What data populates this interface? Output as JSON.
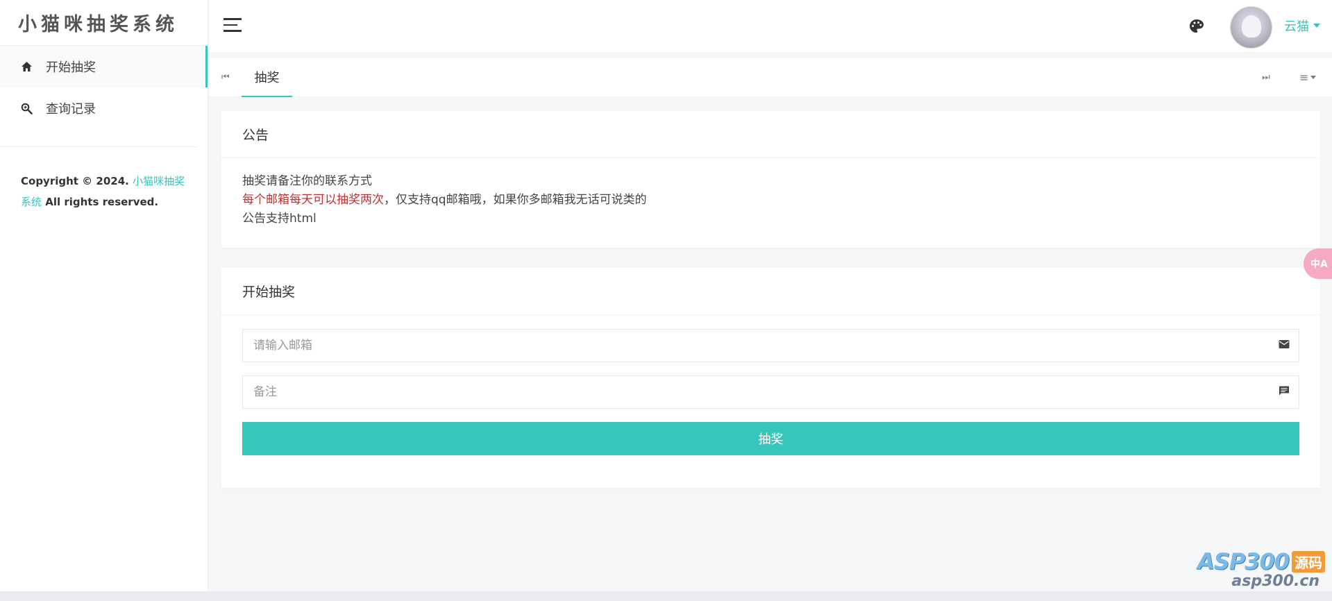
{
  "app": {
    "title": "小猫咪抽奖系统"
  },
  "sidebar": {
    "items": [
      {
        "label": "开始抽奖",
        "icon": "home-icon",
        "active": true
      },
      {
        "label": "查询记录",
        "icon": "search-icon",
        "active": false
      }
    ],
    "copyright": {
      "prefix": "Copyright © 2024. ",
      "brand": "小猫咪抽奖系统",
      "suffix": " All rights reserved."
    }
  },
  "header": {
    "user": "云猫",
    "theme_icon": "palette-icon"
  },
  "tabs": [
    {
      "label": "抽奖",
      "active": true
    }
  ],
  "notice": {
    "title": "公告",
    "line1": "抽奖请备注你的联系方式",
    "line2_red": "每个邮箱每天可以抽奖两次",
    "line2_rest": "，仅支持qq邮箱哦，如果你多邮箱我无话可说类的",
    "line3": "公告支持html"
  },
  "draw": {
    "title": "开始抽奖",
    "email_placeholder": "请输入邮箱",
    "email_value": "",
    "remark_placeholder": "备注",
    "remark_value": "",
    "button": "抽奖"
  },
  "watermark": {
    "logo": "ASP300",
    "badge": "源码",
    "url": "asp300.cn"
  },
  "colors": {
    "accent": "#36c6bb",
    "notice_red": "#c4302b",
    "translate_fab": "#f6a9c4"
  }
}
